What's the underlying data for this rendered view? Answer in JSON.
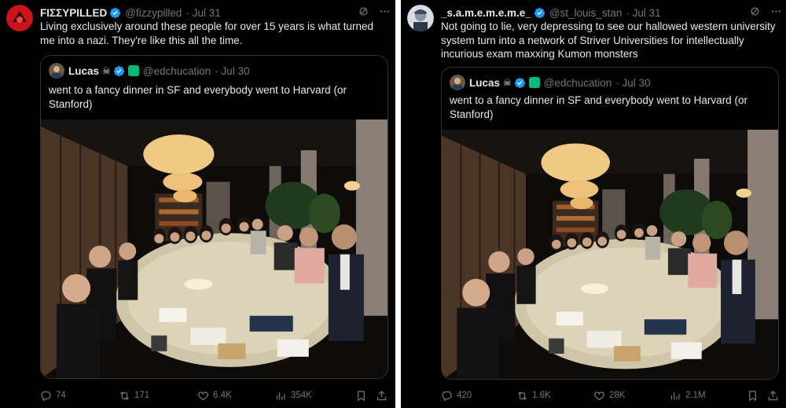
{
  "tweets": [
    {
      "author": "FIΣΣYPILLED",
      "handle": "@fizzypilled",
      "date": "· Jul 31",
      "text": "Living exclusively around these people for over 15 years is what turned me into a nazi. They're like this all the time.",
      "quote": {
        "author": "Lucas",
        "badge": "☠",
        "handle": "@edchucation",
        "date": "· Jul 30",
        "text": "went to a fancy dinner in SF and everybody went to Harvard (or Stanford)"
      },
      "stats": {
        "replies": "74",
        "reposts": "171",
        "likes": "6.4K",
        "views": "354K"
      }
    },
    {
      "author": "_s.a.m.e.m.e.m.e_",
      "handle": "@st_louis_stan",
      "date": "· Jul 31",
      "text": "Not going to lie, very depressing to see our hallowed western university system turn into a network of Striver Universities for intellectually incurious exam maxxing Kumon monsters",
      "quote": {
        "author": "Lucas",
        "badge": "☠",
        "handle": "@edchucation",
        "date": "· Jul 30",
        "text": "went to a fancy dinner in SF and everybody went to Harvard (or Stanford)"
      },
      "stats": {
        "replies": "420",
        "reposts": "1.6K",
        "likes": "28K",
        "views": "2.1M"
      }
    }
  ],
  "colors": {
    "accent": "#1d9bf0",
    "muted": "#71767b",
    "green_badge": "#00ba7c",
    "background": "#000000"
  },
  "icons": [
    "verified-badge-icon",
    "grok-icon",
    "more-icon",
    "reply-icon",
    "repost-icon",
    "like-icon",
    "views-icon",
    "bookmark-icon",
    "share-icon"
  ]
}
